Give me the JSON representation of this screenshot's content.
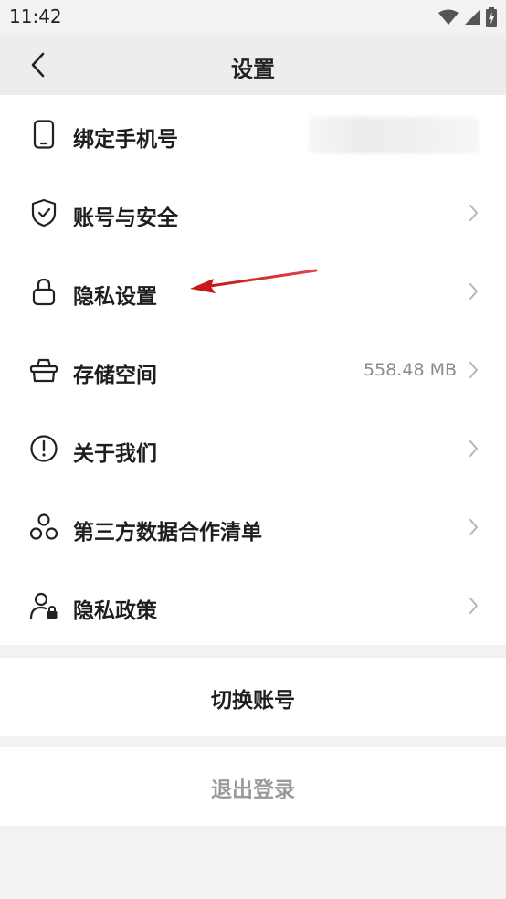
{
  "status_bar": {
    "time": "11:42",
    "icons": [
      "wifi-icon",
      "signal-icon",
      "battery-charging-icon"
    ]
  },
  "header": {
    "title": "设置",
    "back_icon": "chevron-left-icon"
  },
  "settings": {
    "items": [
      {
        "label": "绑定手机号",
        "icon": "phone-icon",
        "value": "",
        "value_blurred": true
      },
      {
        "label": "账号与安全",
        "icon": "shield-check-icon",
        "value": ""
      },
      {
        "label": "隐私设置",
        "icon": "lock-icon",
        "value": ""
      },
      {
        "label": "存储空间",
        "icon": "basket-icon",
        "value": "558.48 MB"
      },
      {
        "label": "关于我们",
        "icon": "info-exclamation-icon",
        "value": ""
      },
      {
        "label": "第三方数据合作清单",
        "icon": "network-icon",
        "value": ""
      },
      {
        "label": "隐私政策",
        "icon": "user-lock-icon",
        "value": ""
      }
    ]
  },
  "actions": {
    "switch_account": "切换账号",
    "logout": "退出登录"
  },
  "colors": {
    "background": "#f2f2f2",
    "card": "#ffffff",
    "text": "#1e1e1e",
    "muted": "#8c8c8c",
    "logout_text": "#9a9a9a",
    "annotation_arrow": "#d32020"
  }
}
